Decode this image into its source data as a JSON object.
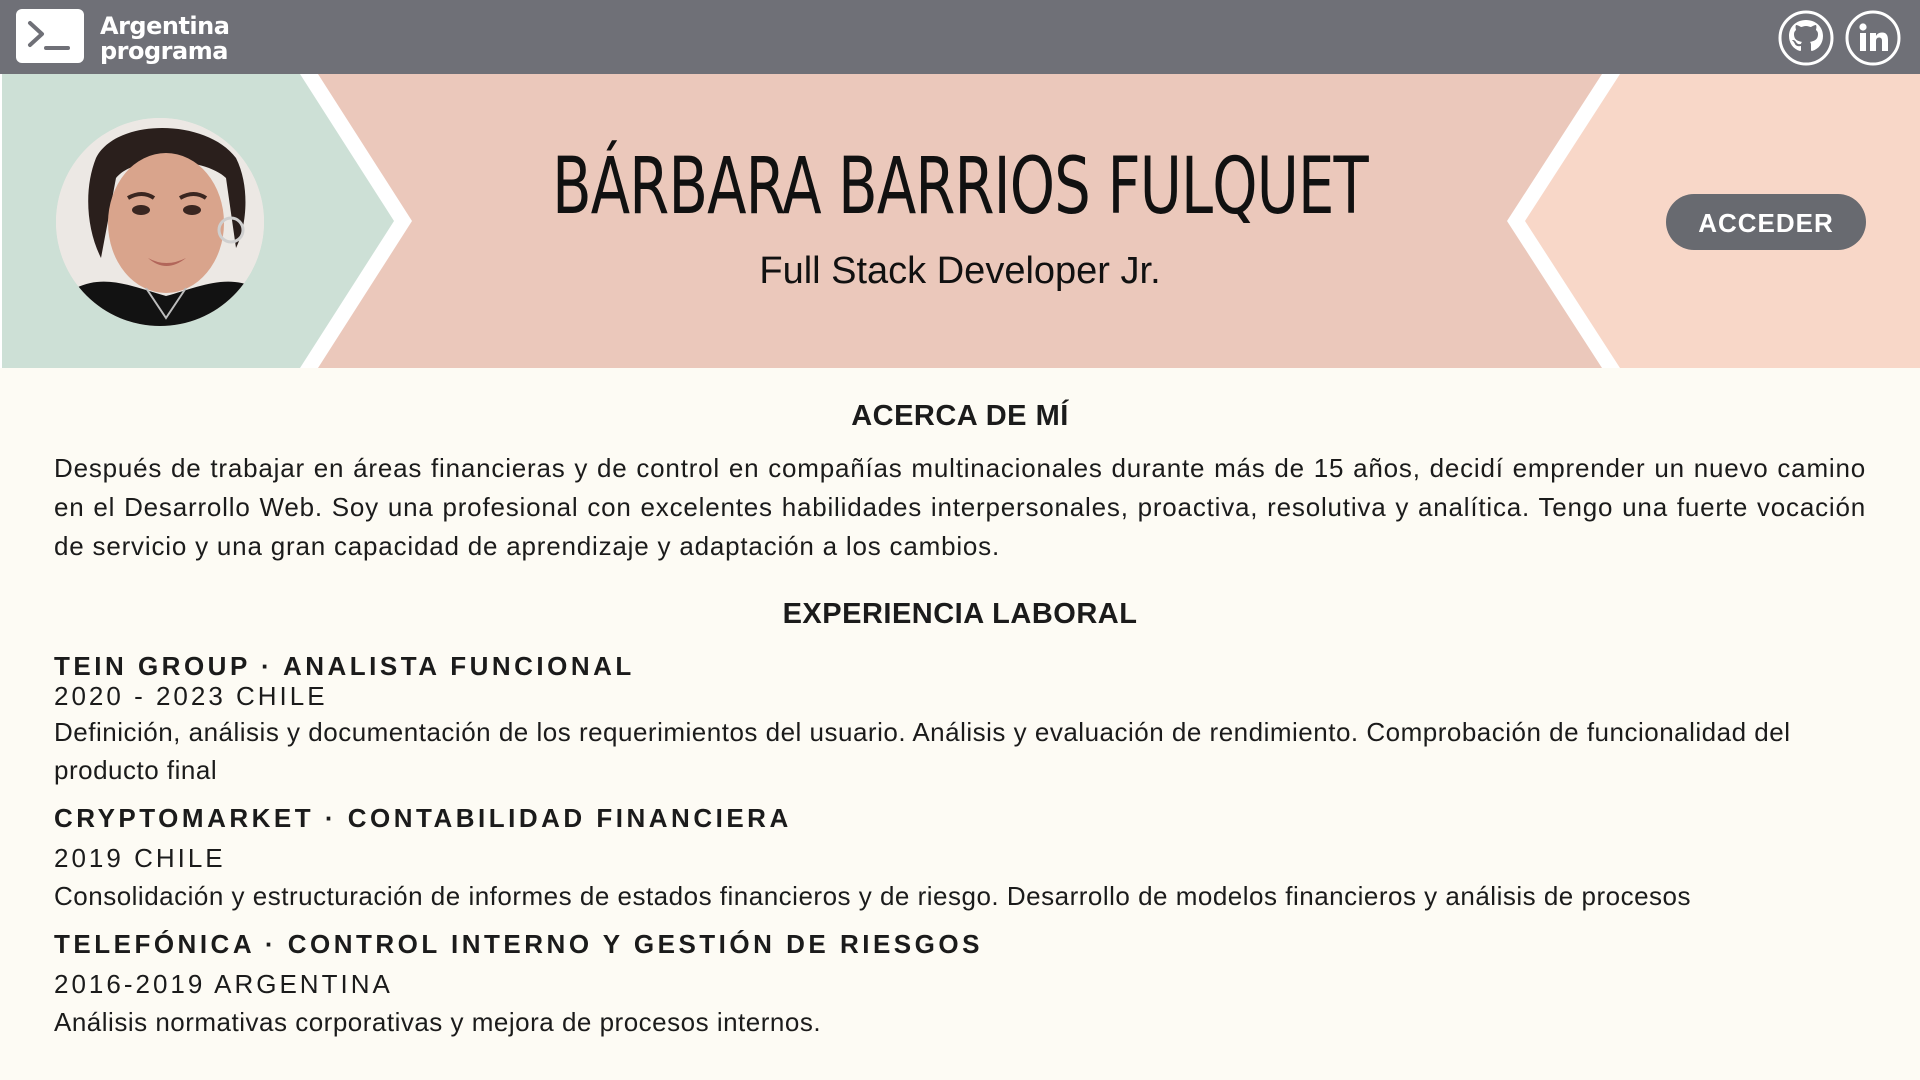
{
  "header": {
    "logo_line1": "Argentina",
    "logo_line2": "programa",
    "logo_icon": "terminal-icon",
    "social": [
      {
        "name": "github",
        "icon": "github-icon"
      },
      {
        "name": "linkedin",
        "icon": "linkedin-icon"
      }
    ],
    "bar_color": "#6f7077"
  },
  "banner": {
    "name": "BÁRBARA BARRIOS FULQUET",
    "role": "Full Stack Developer Jr.",
    "button_label": "ACCEDER",
    "colors": {
      "left": "#cde0d6",
      "center": "#ebc8bb",
      "right": "#f8d7c8",
      "button": "#686a70"
    }
  },
  "about": {
    "title": "ACERCA DE MÍ",
    "text": "Después de trabajar en áreas financieras y de control en compañías multinacionales durante más de 15 años, decidí emprender un nuevo camino en el Desarrollo Web. Soy una profesional con excelentes habilidades interpersonales, proactiva, resolutiva y analítica. Tengo una fuerte vocación de servicio y una gran capacidad de aprendizaje y adaptación a los cambios."
  },
  "experience": {
    "title": "EXPERIENCIA LABORAL",
    "jobs": [
      {
        "heading": "TEIN GROUP · ANALISTA FUNCIONAL",
        "date": "2020 - 2023 CHILE",
        "description": "Definición, análisis y documentación de los requerimientos del usuario. Análisis y evaluación de rendimiento. Comprobación de funcionalidad del producto final"
      },
      {
        "heading": "CRYPTOMARKET · CONTABILIDAD FINANCIERA",
        "date": "2019 CHILE",
        "description": "Consolidación y estructuración de informes de estados financieros y de riesgo. Desarrollo de modelos financieros y análisis de procesos"
      },
      {
        "heading": "TELEFÓNICA · CONTROL INTERNO Y GESTIÓN DE RIESGOS",
        "date": "2016-2019 ARGENTINA",
        "description": "Análisis normativas corporativas y mejora de procesos internos."
      }
    ]
  },
  "background_color": "#fdfbf4"
}
